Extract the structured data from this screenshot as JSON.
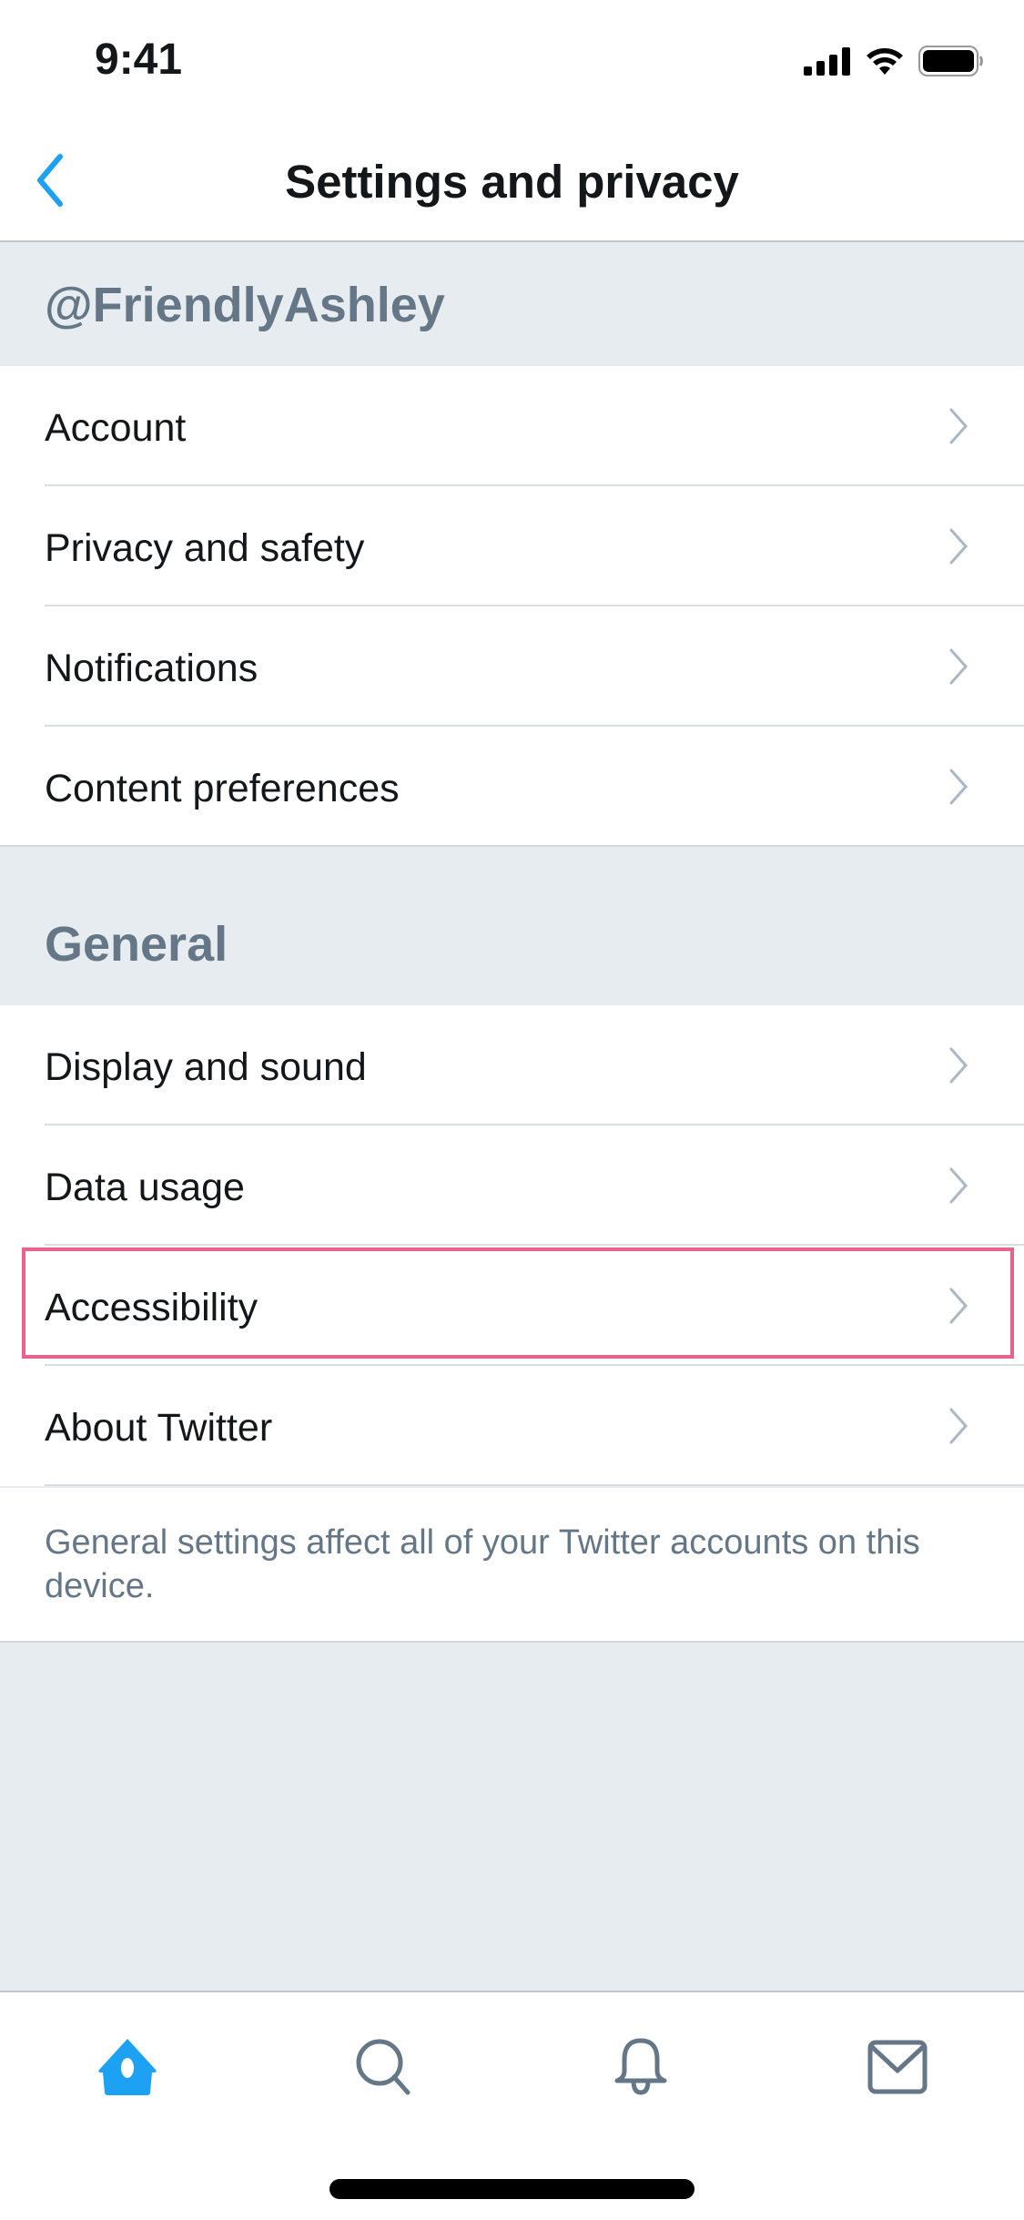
{
  "status_bar": {
    "time": "9:41",
    "icons": [
      "cellular-signal-icon",
      "wifi-icon",
      "battery-icon"
    ]
  },
  "nav": {
    "back_icon": "chevron-left-icon",
    "title": "Settings and privacy"
  },
  "account_section": {
    "header": "@FriendlyAshley",
    "items": [
      {
        "label": "Account"
      },
      {
        "label": "Privacy and safety"
      },
      {
        "label": "Notifications"
      },
      {
        "label": "Content preferences"
      }
    ]
  },
  "general_section": {
    "header": "General",
    "items": [
      {
        "label": "Display and sound"
      },
      {
        "label": "Data usage"
      },
      {
        "label": "Accessibility",
        "highlighted": true
      },
      {
        "label": "About Twitter"
      }
    ],
    "footer": "General settings affect all of your Twitter accounts on this device."
  },
  "tab_bar": {
    "tabs": [
      {
        "name": "Home",
        "icon": "home-icon",
        "active": true
      },
      {
        "name": "Search",
        "icon": "search-icon",
        "active": false
      },
      {
        "name": "Notifications",
        "icon": "bell-icon",
        "active": false
      },
      {
        "name": "Messages",
        "icon": "envelope-icon",
        "active": false
      }
    ]
  },
  "colors": {
    "accent": "#1da1f2",
    "highlight_border": "#e8638c",
    "section_bg": "#e6ecf0",
    "secondary_text": "#657786",
    "chevron": "#aab8c2"
  }
}
